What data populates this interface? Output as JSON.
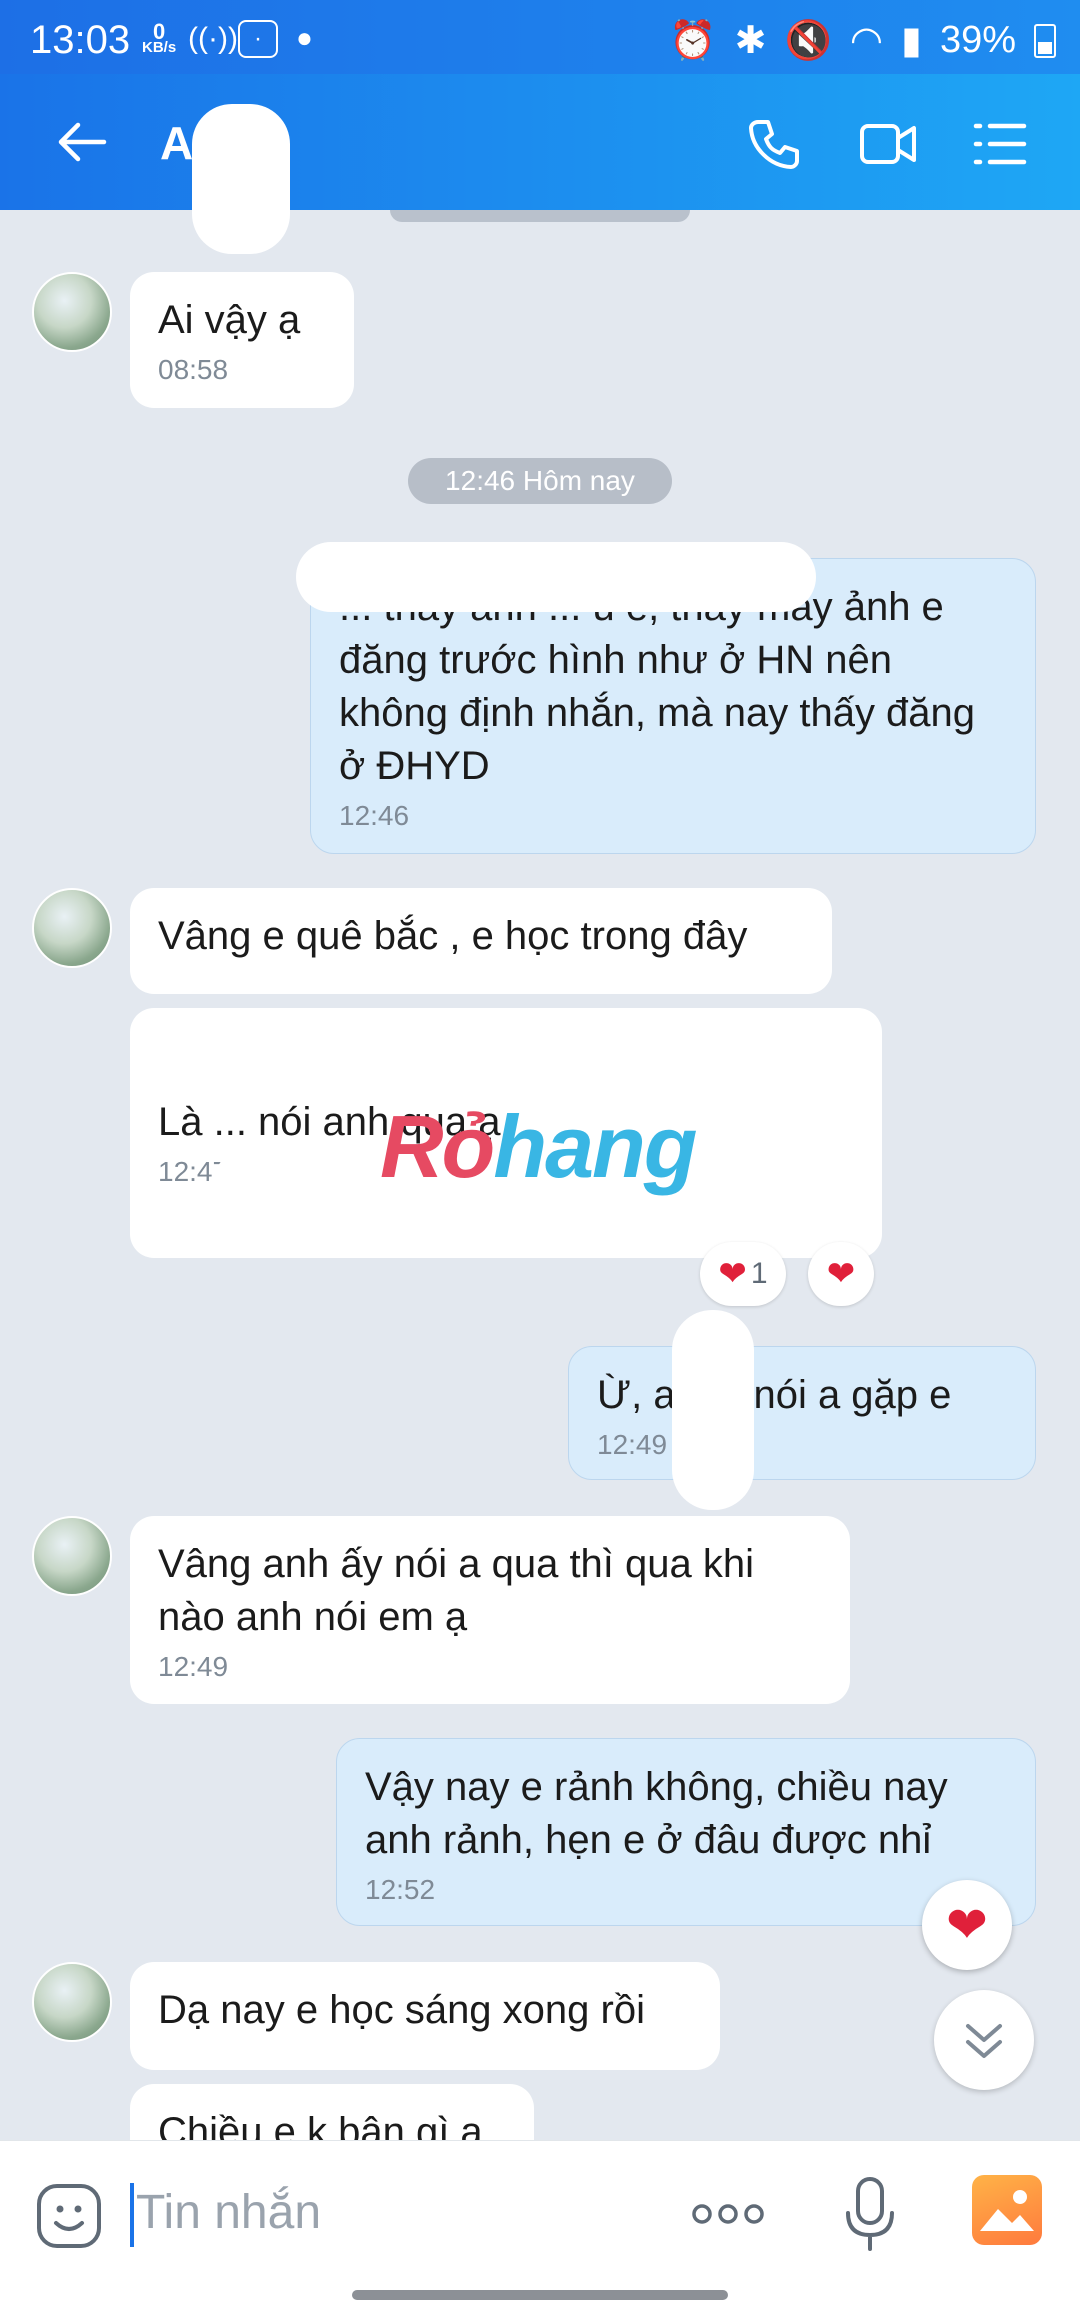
{
  "status_bar": {
    "time": "13:03",
    "net_speed_value": "0",
    "net_speed_unit": "KB/s",
    "battery": "39%"
  },
  "header": {
    "contact_name": "Ag"
  },
  "messages": [
    {
      "dir": "in",
      "text": "Ai vậy ạ",
      "time": "08:58"
    },
    {
      "dir": "chip",
      "text": "12:46 Hôm nay"
    },
    {
      "dir": "out",
      "text": "... thấy anh ... u e, thấy mấy ảnh e đăng trước hình như ở HN nên không định nhắn, mà nay thấy đăng ở ĐHYD",
      "time": "12:46"
    },
    {
      "dir": "in",
      "text": "Vâng e quê bắc , e học trong đây"
    },
    {
      "dir": "in",
      "text": "Là ... nói anh qua ạ",
      "time": "12:47",
      "reactions": [
        {
          "emoji": "❤",
          "count": "1"
        },
        {
          "emoji": "❤"
        }
      ]
    },
    {
      "dir": "out",
      "text": "Ừ, a... ó nói a gặp e",
      "time": "12:49"
    },
    {
      "dir": "in",
      "text": "Vâng anh ấy nói a qua thì qua khi nào anh nói em ạ",
      "time": "12:49"
    },
    {
      "dir": "out",
      "text": "Vậy nay e rảnh không, chiều nay anh rảnh, hẹn e ở đâu được nhỉ",
      "time": "12:52"
    },
    {
      "dir": "in",
      "text": "Dạ nay e học sáng xong rồi"
    },
    {
      "dir": "in",
      "text": "Chiều e k bận gì ạ"
    }
  ],
  "watermark": {
    "part1": "Rỏ",
    "part2": "hang"
  },
  "composer": {
    "placeholder": "Tin nhắn"
  },
  "icons": [
    "back-arrow-icon",
    "phone-icon",
    "video-call-icon",
    "menu-icon",
    "emoji-icon",
    "more-icon",
    "microphone-icon",
    "gallery-icon",
    "heart-icon",
    "chevron-double-down-icon"
  ]
}
